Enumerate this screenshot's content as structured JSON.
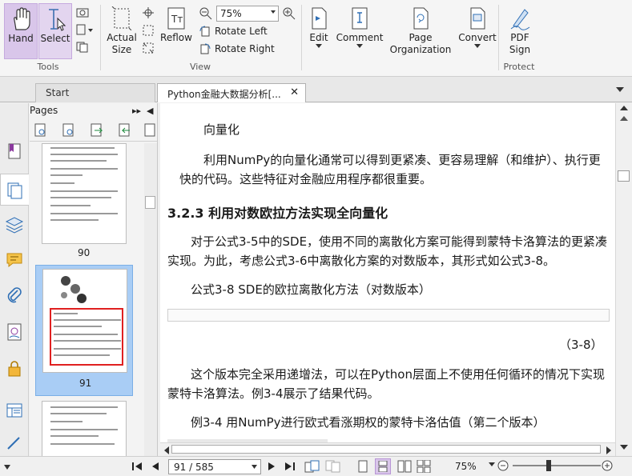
{
  "ribbon": {
    "hand_label": "Hand",
    "select_label": "Select",
    "tools_group_label": "Tools",
    "actual_size_label": "Actual\nSize",
    "reflow_label": "Reflow",
    "zoom_value": "75%",
    "rotate_left_label": "Rotate Left",
    "rotate_right_label": "Rotate Right",
    "view_group_label": "View",
    "edit_label": "Edit",
    "comment_label": "Comment",
    "page_org_label": "Page\nOrganization",
    "convert_label": "Convert",
    "pdf_sign_label": "PDF\nSign",
    "protect_group_label": "Protect"
  },
  "tabs": {
    "start_label": "Start",
    "doc_label": "Python金融大数据分析[..."
  },
  "pages_panel": {
    "title": "Pages",
    "page_90": "90",
    "page_91": "91"
  },
  "document": {
    "line1": "向量化",
    "line2": "利用NumPy的向量化通常可以得到更紧凑、更容易理解（和维护）、执行更",
    "line3": "快的代码。这些特征对金融应用程序都很重要。",
    "heading": "3.2.3   利用对数欧拉方法实现全向量化",
    "line4": "对于公式3-5中的SDE，使用不同的离散化方案可能得到蒙特卡洛算法的更紧凑",
    "line5": "实现。为此，考虑公式3-6中离散化方案的对数版本，其形式如公式3-8。",
    "formula_caption": "公式3-8   SDE的欧拉离散化方法（对数版本）",
    "formula_number": "（3-8）",
    "line6": "这个版本完全采用递增法，可以在Python层面上不使用任何循环的情况下实现",
    "line7": "蒙特卡洛算法。例3-4展示了结果代码。",
    "example_caption": "例3-4   用NumPy进行欧式看涨期权的蒙特卡洛估值（第二个版本）"
  },
  "status": {
    "page_indicator": "91 / 585",
    "zoom": "75%"
  }
}
